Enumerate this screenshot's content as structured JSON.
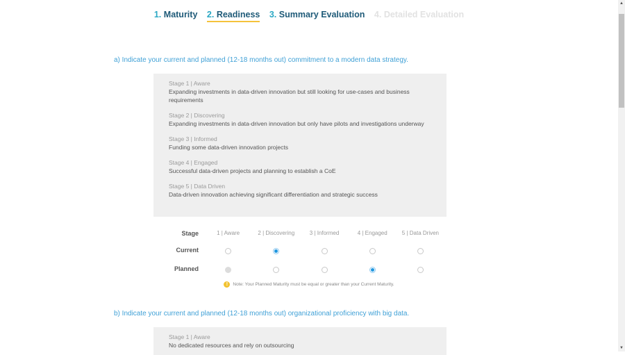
{
  "steps": [
    {
      "num": "1.",
      "label": "Maturity",
      "state": "done"
    },
    {
      "num": "2.",
      "label": "Readiness",
      "state": "active"
    },
    {
      "num": "3.",
      "label": "Summary Evaluation",
      "state": "done"
    },
    {
      "num": "4.",
      "label": "Detailed Evaluation",
      "state": "disabled"
    }
  ],
  "question_a": {
    "text": "a) Indicate your current and planned (12-18 months out) commitment to a modern data strategy.",
    "stages": [
      {
        "title": "Stage 1 | Aware",
        "desc": "Expanding investments in data-driven innovation but still looking for use-cases and business requirements"
      },
      {
        "title": "Stage 2 | Discovering",
        "desc": "Expanding investments in data-driven innovation but only have pilots and investigations underway"
      },
      {
        "title": "Stage 3 | Informed",
        "desc": "Funding some data-driven innovation projects"
      },
      {
        "title": "Stage 4 | Engaged",
        "desc": "Successful data-driven projects and planning to establish a CoE"
      },
      {
        "title": "Stage 5 | Data Driven",
        "desc": "Data-driven innovation achieving significant differentiation and strategic success"
      }
    ],
    "grid": {
      "stage_label": "Stage",
      "columns": [
        "1 | Aware",
        "2 | Discovering",
        "3 | Informed",
        "4 | Engaged",
        "5 | Data Driven"
      ],
      "current_label": "Current",
      "planned_label": "Planned",
      "current_selected": 2,
      "planned_selected": 4,
      "planned_disabled": [
        1
      ]
    },
    "note": "Note: Your Planned Maturity must be equal or greater than your Current Maturity.",
    "note_icon": "info-icon"
  },
  "question_b": {
    "text": "b) Indicate your current and planned (12-18 months out) organizational proficiency with big data.",
    "stages": [
      {
        "title": "Stage 1 | Aware",
        "desc": "No dedicated resources and rely on outsourcing"
      }
    ]
  },
  "colors": {
    "accent": "#3fa0d6",
    "step_active_underline": "#f5c33b",
    "radio_selected": "#1f97e0",
    "panel_bg": "#efefef"
  }
}
